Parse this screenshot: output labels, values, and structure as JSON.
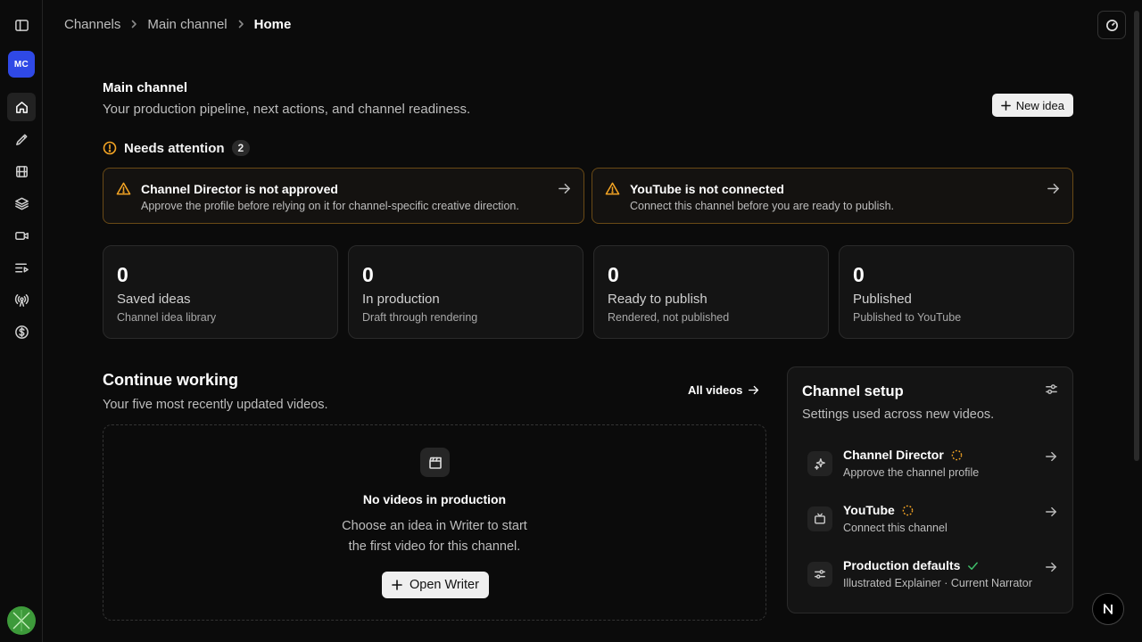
{
  "breadcrumb": {
    "items": [
      "Channels",
      "Main channel"
    ],
    "current": "Home"
  },
  "sidebar": {
    "channel_badge": "MC"
  },
  "header": {
    "title": "Main channel",
    "subtitle": "Your production pipeline, next actions, and channel readiness.",
    "new_idea_label": "New idea"
  },
  "attention": {
    "title": "Needs attention",
    "count": "2",
    "alerts": [
      {
        "title": "Channel Director is not approved",
        "description": "Approve the profile before relying on it for channel-specific creative direction."
      },
      {
        "title": "YouTube is not connected",
        "description": "Connect this channel before you are ready to publish."
      }
    ]
  },
  "stats": [
    {
      "value": "0",
      "label": "Saved ideas",
      "sub": "Channel idea library"
    },
    {
      "value": "0",
      "label": "In production",
      "sub": "Draft through rendering"
    },
    {
      "value": "0",
      "label": "Ready to publish",
      "sub": "Rendered, not published"
    },
    {
      "value": "0",
      "label": "Published",
      "sub": "Published to YouTube"
    }
  ],
  "continue_working": {
    "title": "Continue working",
    "subtitle": "Your five most recently updated videos.",
    "all_videos_label": "All videos",
    "empty_title": "No videos in production",
    "empty_line1": "Choose an idea in Writer to start",
    "empty_line2": "the first video for this channel.",
    "open_writer_label": "Open Writer"
  },
  "channel_setup": {
    "title": "Channel setup",
    "subtitle": "Settings used across new videos.",
    "items": [
      {
        "name": "Channel Director",
        "description": "Approve the channel profile",
        "status": "pending"
      },
      {
        "name": "YouTube",
        "description": "Connect this channel",
        "status": "pending"
      },
      {
        "name": "Production defaults",
        "description": "Illustrated Explainer · Current Narrator",
        "status": "done"
      }
    ]
  },
  "colors": {
    "warning": "#f5a524",
    "success": "#3fbf6a",
    "accent": "#2f49e6",
    "alert_border": "#6a4a16"
  }
}
